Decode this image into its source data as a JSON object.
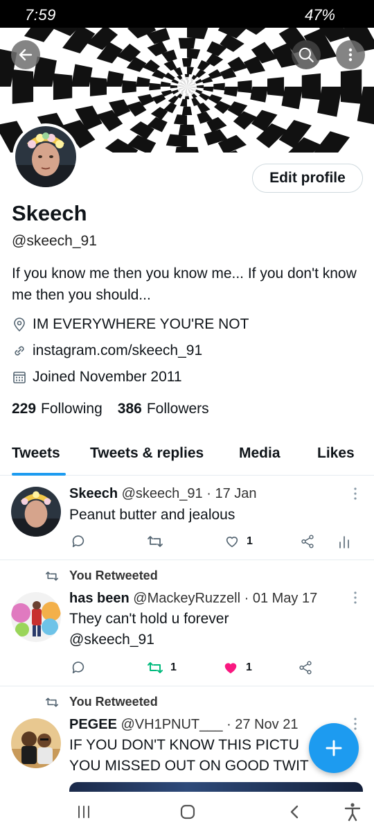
{
  "status_bar": {
    "time": "7:59",
    "battery": "47%"
  },
  "profile": {
    "name": "Skeech",
    "handle": "@skeech_91",
    "bio": "If you know me then you know me... If you don't know me then you should...",
    "location": "IM EVERYWHERE YOU'RE NOT",
    "website": "instagram.com/skeech_91",
    "joined": "Joined November 2011",
    "following_count": "229",
    "following_label": "Following",
    "followers_count": "386",
    "followers_label": "Followers",
    "edit_label": "Edit profile"
  },
  "tabs": [
    {
      "label": "Tweets",
      "active": true
    },
    {
      "label": "Tweets & replies",
      "active": false
    },
    {
      "label": "Media",
      "active": false
    },
    {
      "label": "Likes",
      "active": false
    }
  ],
  "tweets": [
    {
      "retweeted_label": "",
      "name": "Skeech",
      "handle": "@skeech_91",
      "date": "· 17 Jan",
      "text": "Peanut butter and jealous",
      "retweets": "",
      "likes": "1",
      "liked": false,
      "retweeted": false
    },
    {
      "retweeted_label": "You Retweeted",
      "name": "has been",
      "handle": "@MackeyRuzzell",
      "date": "· 01 May 17",
      "text": "They can't hold u forever",
      "mention": "@skeech_91",
      "retweets": "1",
      "likes": "1",
      "liked": true,
      "retweeted": true
    },
    {
      "retweeted_label": "You Retweeted",
      "name": "PEGEE",
      "handle": "@VH1PNUT___",
      "date": "· 27 Nov 21",
      "text_line1": "IF YOU DON'T KNOW THIS PICTU",
      "text_line2": "YOU MISSED OUT ON GOOD TWIT"
    }
  ],
  "colors": {
    "accent": "#1d9bf0",
    "like": "#f91880",
    "retweet": "#00ba7c"
  },
  "icons": [
    "back-arrow-icon",
    "search-icon",
    "more-vertical-icon",
    "location-pin-icon",
    "link-icon",
    "calendar-icon",
    "reply-icon",
    "retweet-icon",
    "heart-icon",
    "share-icon",
    "analytics-icon",
    "plus-icon"
  ]
}
